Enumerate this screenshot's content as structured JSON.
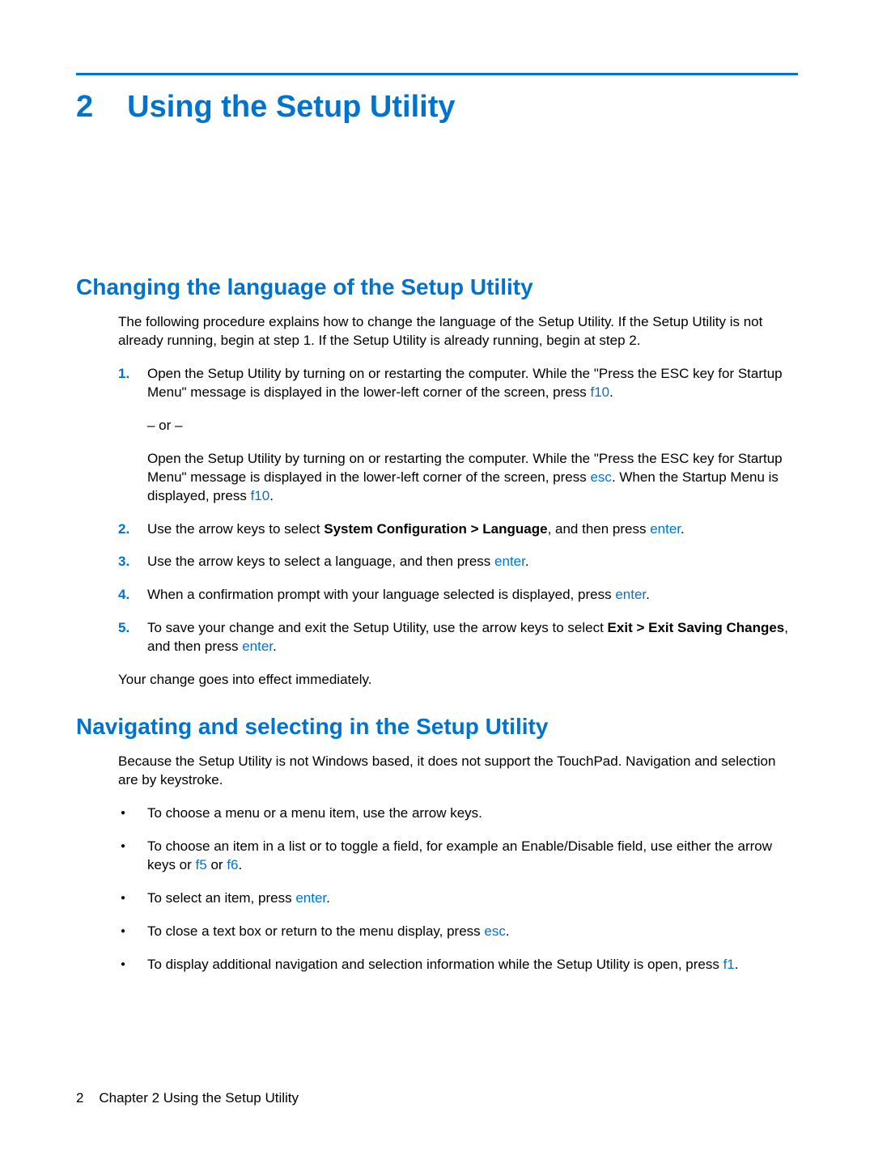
{
  "chapter": {
    "number": "2",
    "title": "Using the Setup Utility"
  },
  "section1": {
    "heading": "Changing the language of the Setup Utility",
    "intro": "The following procedure explains how to change the language of the Setup Utility. If the Setup Utility is not already running, begin at step 1. If the Setup Utility is already running, begin at step 2.",
    "step1_a": "Open the Setup Utility by turning on or restarting the computer. While the \"Press the ESC key for Startup Menu\" message is displayed in the lower-left corner of the screen, press ",
    "step1_key1": "f10",
    "step1_period": ".",
    "step1_or": "– or –",
    "step1_b": "Open the Setup Utility by turning on or restarting the computer. While the \"Press the ESC key for Startup Menu\" message is displayed in the lower-left corner of the screen, press ",
    "step1_key2": "esc",
    "step1_b2": ". When the Startup Menu is displayed, press ",
    "step1_key3": "f10",
    "step2_a": "Use the arrow keys to select ",
    "step2_bold": "System Configuration > Language",
    "step2_b": ", and then press ",
    "step2_key": "enter",
    "step3_a": "Use the arrow keys to select a language, and then press ",
    "step3_key": "enter",
    "step4_a": "When a confirmation prompt with your language selected is displayed, press ",
    "step4_key": "enter",
    "step5_a": "To save your change and exit the Setup Utility, use the arrow keys to select ",
    "step5_bold": "Exit > Exit Saving Changes",
    "step5_b": ", and then press ",
    "step5_key": "enter",
    "closing": "Your change goes into effect immediately."
  },
  "section2": {
    "heading": "Navigating and selecting in the Setup Utility",
    "intro": "Because the Setup Utility is not Windows based, it does not support the TouchPad. Navigation and selection are by keystroke.",
    "b1": "To choose a menu or a menu item, use the arrow keys.",
    "b2_a": "To choose an item in a list or to toggle a field, for example an Enable/Disable field, use either the arrow keys or ",
    "b2_key1": "f5",
    "b2_or": " or ",
    "b2_key2": "f6",
    "b3_a": "To select an item, press ",
    "b3_key": "enter",
    "b4_a": "To close a text box or return to the menu display, press ",
    "b4_key": "esc",
    "b5_a": "To display additional navigation and selection information while the Setup Utility is open, press ",
    "b5_key": "f1"
  },
  "footer": {
    "pagenum": "2",
    "chapter_label": "Chapter 2   Using the Setup Utility"
  }
}
